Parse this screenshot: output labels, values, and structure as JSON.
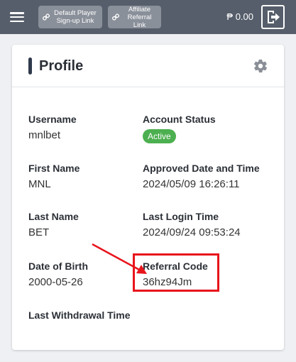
{
  "topbar": {
    "links": [
      {
        "label": "Default Player\nSign-up Link",
        "icon": "link-icon"
      },
      {
        "label": "Affiliate\nReferral\nLink",
        "icon": "link-icon"
      }
    ],
    "balance": "₱ 0.00",
    "icons": {
      "menu": "hamburger-icon",
      "logout": "logout-icon"
    }
  },
  "profile": {
    "title": "Profile",
    "settings_icon": "gear-icon",
    "fields": {
      "username": {
        "label": "Username",
        "value": "mnlbet"
      },
      "account_status": {
        "label": "Account Status",
        "value": "Active"
      },
      "first_name": {
        "label": "First Name",
        "value": "MNL"
      },
      "approved": {
        "label": "Approved Date and Time",
        "value": "2024/05/09 16:26:11"
      },
      "last_name": {
        "label": "Last Name",
        "value": "BET"
      },
      "last_login": {
        "label": "Last Login Time",
        "value": "2024/09/24 09:53:24"
      },
      "dob": {
        "label": "Date of Birth",
        "value": "2000-05-26"
      },
      "referral_code": {
        "label": "Referral Code",
        "value": "36hz94Jm"
      },
      "last_withdrawal": {
        "label": "Last Withdrawal Time",
        "value": ""
      }
    }
  },
  "colors": {
    "topbar": "#565e6b",
    "active_badge": "#4caf50",
    "annotation": "#e8141c"
  }
}
